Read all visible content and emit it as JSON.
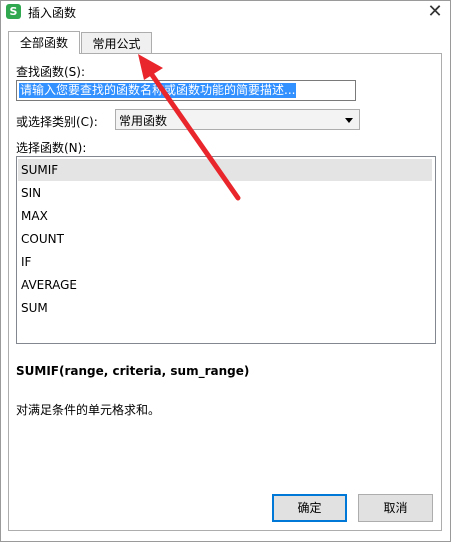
{
  "window": {
    "title": "插入函数",
    "app_icon_glyph": "S",
    "close_glyph": "✕"
  },
  "tabs": [
    {
      "label": "全部函数",
      "active": true
    },
    {
      "label": "常用公式",
      "active": false
    }
  ],
  "search": {
    "label": "查找函数(S):",
    "value": "请输入您要查找的函数名称或函数功能的简要描述..."
  },
  "category": {
    "label": "或选择类别(C):",
    "selected": "常用函数"
  },
  "function_list": {
    "label": "选择函数(N):",
    "items": [
      "SUMIF",
      "SIN",
      "MAX",
      "COUNT",
      "IF",
      "AVERAGE",
      "SUM"
    ],
    "selected_index": 0
  },
  "signature": "SUMIF(range, criteria, sum_range)",
  "description": "对满足条件的单元格求和。",
  "buttons": {
    "ok": "确定",
    "cancel": "取消"
  },
  "annotation": {
    "arrow_color": "#e8262b"
  },
  "accent": {
    "selection": "#3390ff",
    "ok_border": "#0078d7"
  }
}
